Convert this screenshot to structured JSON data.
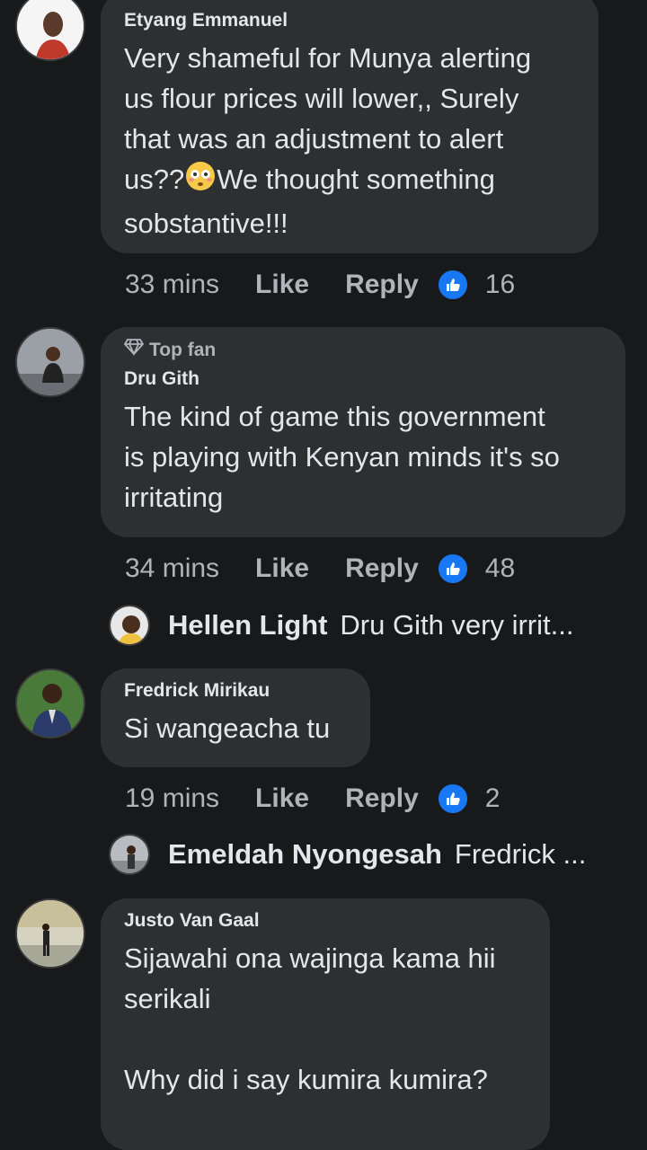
{
  "comments": [
    {
      "author": "Etyang Emmanuel",
      "text_line1": "Very shameful for Munya alerting",
      "text_line2": "us flour prices will lower,, Surely",
      "text_line3": "that was an adjustment to alert",
      "text_line4a": "us??",
      "text_line4b": "We thought something",
      "text_line5": "sobstantive!!!",
      "time": "33 mins",
      "like": "Like",
      "reply": "Reply",
      "reactions": "16"
    },
    {
      "badge": "Top fan",
      "author": "Dru Gith",
      "text_line1": "The kind of game this government",
      "text_line2": "is playing with Kenyan minds it's so",
      "text_line3": "irritating",
      "time": "34 mins",
      "like": "Like",
      "reply": "Reply",
      "reactions": "48",
      "reply_preview": {
        "name": "Hellen Light",
        "text": "Dru Gith very irrit..."
      }
    },
    {
      "author": "Fredrick Mirikau",
      "text_line1": "Si wangeacha tu",
      "time": "19 mins",
      "like": "Like",
      "reply": "Reply",
      "reactions": "2",
      "reply_preview": {
        "name": "Emeldah Nyongesah",
        "text": "Fredrick ..."
      }
    },
    {
      "author": "Justo Van Gaal",
      "text_line1": "Sijawahi ona wajinga kama hii",
      "text_line2": "serikali",
      "text_line3": "Why did i say kumira kumira?"
    }
  ],
  "icons": {
    "reaction": "like-thumb-icon",
    "badge": "diamond-icon",
    "emoji": "flushed-face-emoji"
  },
  "colors": {
    "background": "#18191a",
    "bubble": "#2e2f31",
    "like_blue": "#1877f2"
  }
}
